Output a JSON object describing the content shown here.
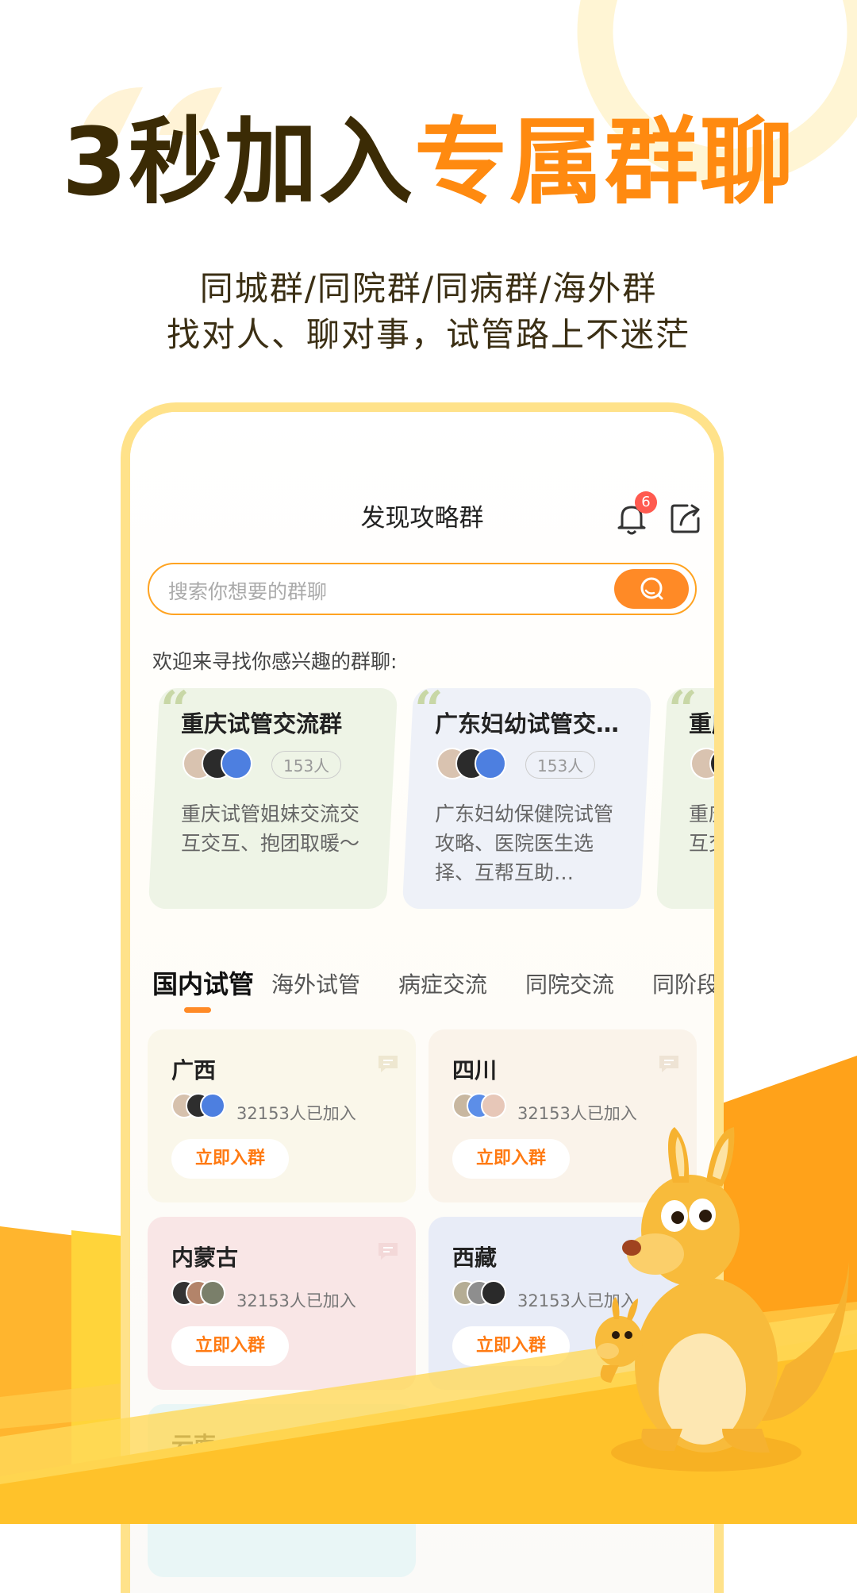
{
  "hero": {
    "title_dark": "3秒加入",
    "title_orange": "专属群聊",
    "subtitle_line1": "同城群/同院群/同病群/海外群",
    "subtitle_line2": "找对人、聊对事，试管路上不迷茫"
  },
  "app": {
    "nav_title": "发现攻略群",
    "notification_count": "6",
    "search_placeholder": "搜索你想要的群聊",
    "welcome_text": "欢迎来寻找你感兴趣的群聊:"
  },
  "featured_groups": [
    {
      "name": "重庆试管交流群",
      "members": "153人",
      "description": "重庆试管姐妹交流交互交互、抱团取暖～",
      "bg": "#eef4e6"
    },
    {
      "name": "广东妇幼试管交…",
      "members": "153人",
      "description": "广东妇幼保健院试管攻略、医院医生选择、互帮互助…",
      "bg": "#eef1f8"
    },
    {
      "name": "重庆",
      "members": "",
      "description": "重庆互交",
      "bg": "#eef4e6"
    }
  ],
  "tabs": [
    "国内试管",
    "海外试管",
    "病症交流",
    "同院交流",
    "同阶段"
  ],
  "active_tab": 0,
  "regions": [
    {
      "name": "广西",
      "count": "32153人已加入",
      "button": "立即入群",
      "bg": "#faf7ea"
    },
    {
      "name": "四川",
      "count": "32153人已加入",
      "button": "立即入群",
      "bg": "#faf3ea"
    },
    {
      "name": "内蒙古",
      "count": "32153人已加入",
      "button": "立即入群",
      "bg": "#f9e6e6"
    },
    {
      "name": "西藏",
      "count": "32153人已加入",
      "button": "立即入群",
      "bg": "#e8ecf7"
    },
    {
      "name": "云南",
      "count": "",
      "button": "",
      "bg": "#e9f6f6"
    }
  ],
  "colors": {
    "accent": "#ff8a10",
    "dark_title": "#3b2b05",
    "phone_border": "#ffe28a",
    "button_orange": "#ff7a12"
  }
}
